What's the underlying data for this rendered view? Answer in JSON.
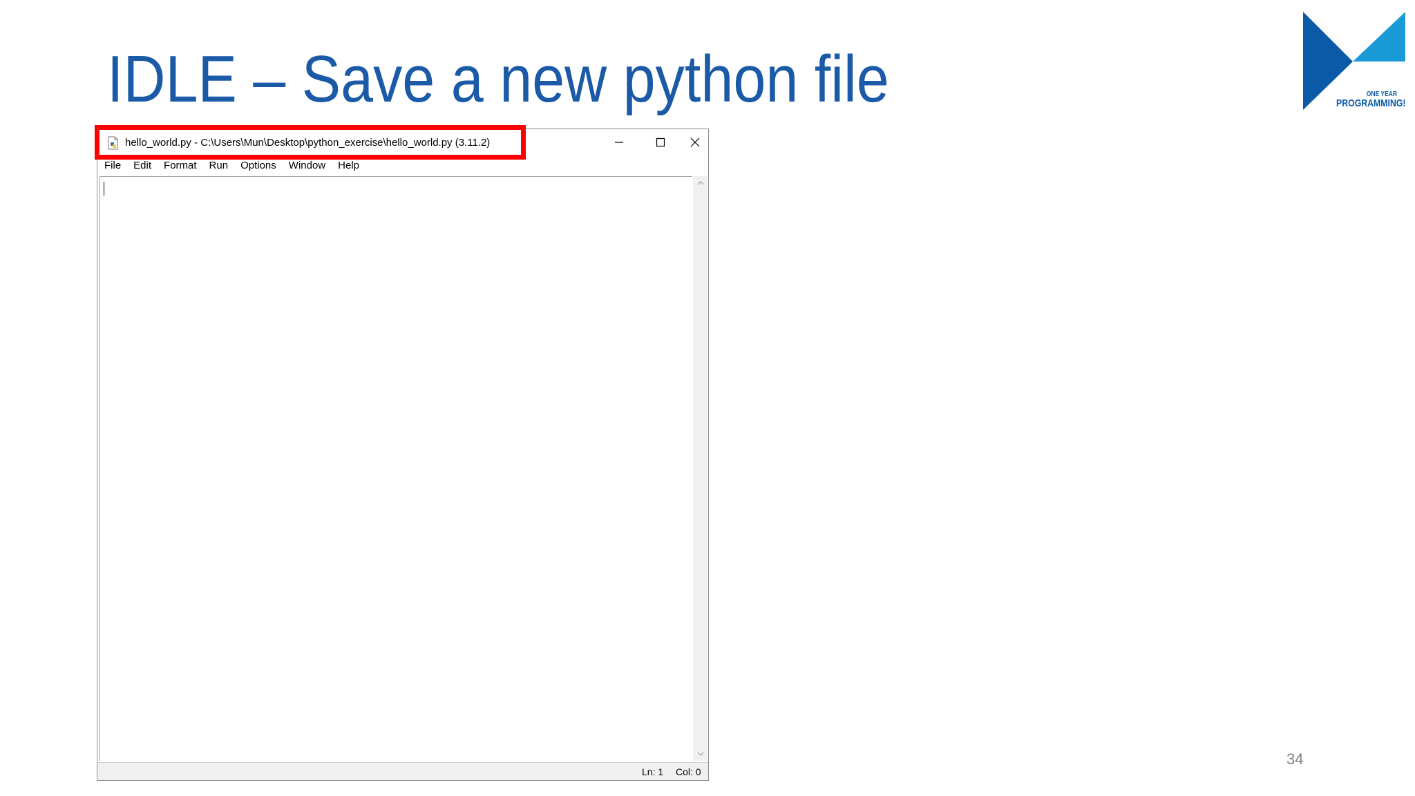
{
  "slide": {
    "title": "IDLE – Save a new python file",
    "page_number": "34",
    "logo": {
      "small_text": "ONE YEAR",
      "big_text": "PROGRAMMING!",
      "colors": {
        "dark_blue": "#0a5aa8",
        "light_blue": "#1a9ad6"
      }
    }
  },
  "window": {
    "title": "hello_world.py - C:\\Users\\Mun\\Desktop\\python_exercise\\hello_world.py (3.11.2)",
    "app_icon": "python-file-icon",
    "controls": {
      "minimize_icon": "minimize-icon",
      "maximize_icon": "maximize-icon",
      "close_icon": "close-icon"
    },
    "menu": [
      "File",
      "Edit",
      "Format",
      "Run",
      "Options",
      "Window",
      "Help"
    ],
    "editor_content": "",
    "status": {
      "line": "Ln: 1",
      "column": "Col: 0"
    },
    "highlight_color": "#ff0000"
  }
}
